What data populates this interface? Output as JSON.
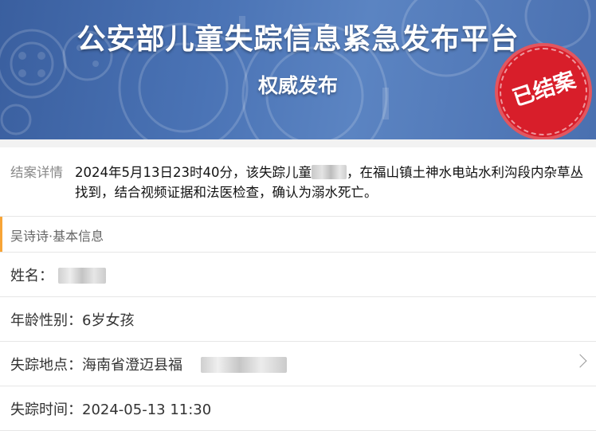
{
  "banner": {
    "title": "公安部儿童失踪信息紧急发布平台",
    "subtitle": "权威发布",
    "stamp": "已结案"
  },
  "case_detail": {
    "label": "结案详情",
    "text_before_name": "2024年5月13日23时40分，该失踪儿童",
    "text_after_name": "，在福山镇土神水电站水利沟段内杂草丛找到，结合视频证据和法医检查，确认为溺水死亡。"
  },
  "basic_info": {
    "section_title": "吴诗诗·基本信息",
    "fields": [
      {
        "label": "姓名：",
        "value": ""
      },
      {
        "label": "年龄性别：",
        "value": "6岁女孩"
      },
      {
        "label": "失踪地点：",
        "value": "海南省澄迈县福"
      },
      {
        "label": "失踪时间：",
        "value": "2024-05-13 11:30"
      }
    ]
  },
  "colors": {
    "banner_blue": "#4a73b5",
    "stamp_red": "#d81e2a",
    "section_accent": "#f7a437"
  },
  "icons": {
    "location_row": "chevron-right-icon"
  }
}
